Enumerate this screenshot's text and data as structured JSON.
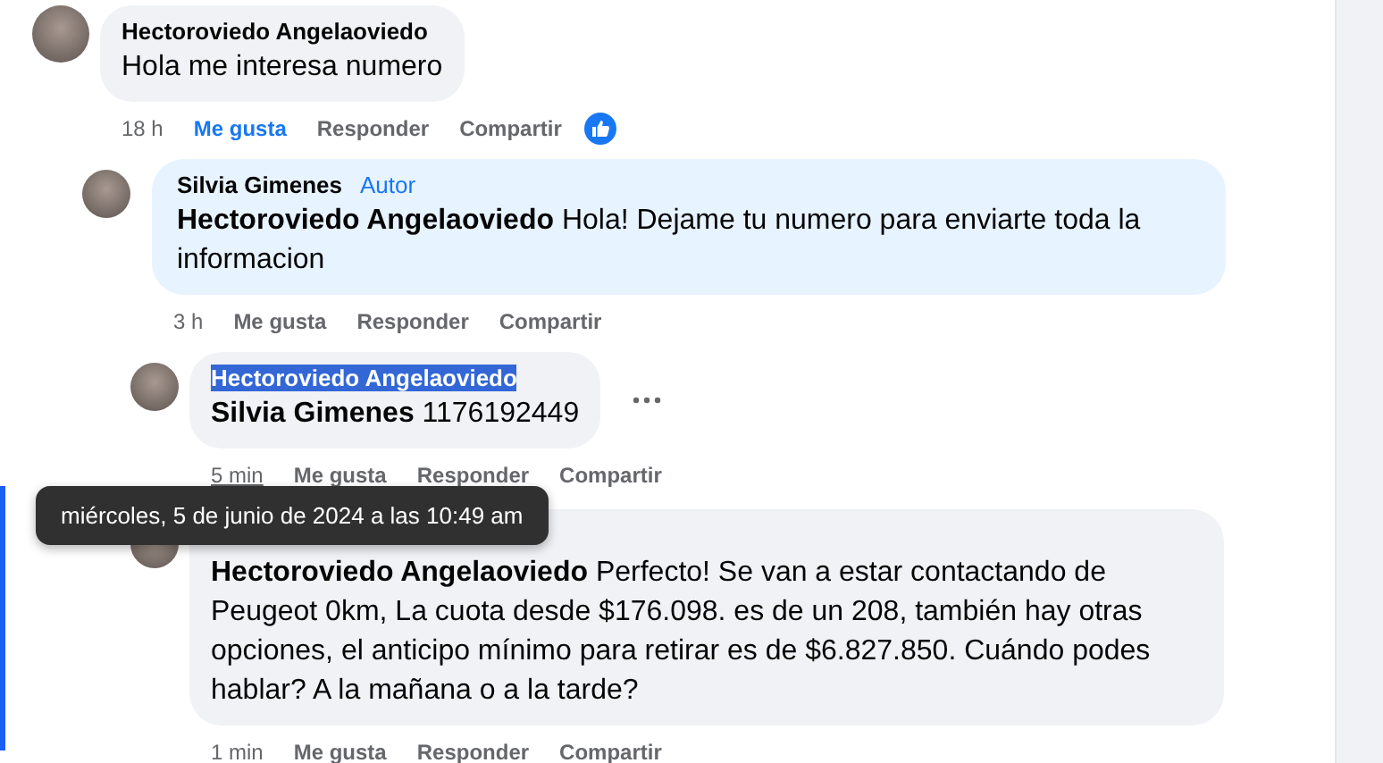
{
  "comments": [
    {
      "author": "Hectoroviedo Angelaoviedo",
      "text": "Hola me interesa numero",
      "time": "18 h",
      "liked": true,
      "reaction": true,
      "actions": [
        "Me gusta",
        "Responder",
        "Compartir"
      ],
      "children": [
        {
          "author": "Silvia Gimenes",
          "badge": "Autor",
          "text": "**Hectoroviedo Angelaoviedo** Hola! Dejame tu numero para enviarte toda la informacion",
          "time": "3 h",
          "liked": false,
          "actions": [
            "Me gusta",
            "Responder",
            "Compartir"
          ],
          "children": [
            {
              "author": "Hectoroviedo Angelaoviedo",
              "author_selected": true,
              "menu": true,
              "text": "**Silvia Gimenes** 1176192449",
              "time": "5 min",
              "time_hovered": true,
              "liked": false,
              "actions": [
                "Me gusta",
                "Responder",
                "Compartir"
              ]
            },
            {
              "text": "**Hectoroviedo Angelaoviedo** Perfecto! Se van a estar contactando de Peugeot 0km, La cuota desde $176.098. es de un 208, también hay otras opciones, el anticipo mínimo para retirar es de $6.827.850. Cuándo podes hablar? A la mañana o a la tarde?",
              "time": "1 min",
              "liked": false,
              "actions": [
                "Me gusta",
                "Responder",
                "Compartir"
              ]
            }
          ]
        }
      ]
    }
  ],
  "tooltip": "miércoles, 5 de junio de 2024 a las 10:49 am"
}
